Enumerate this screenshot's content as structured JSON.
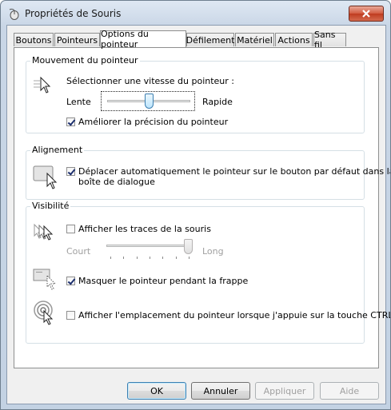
{
  "window": {
    "title": "Propriétés de Souris",
    "close_icon": "close-icon"
  },
  "tabs": [
    {
      "label": "Boutons",
      "active": false
    },
    {
      "label": "Pointeurs",
      "active": false
    },
    {
      "label": "Options du pointeur",
      "active": true
    },
    {
      "label": "Défilement",
      "active": false
    },
    {
      "label": "Matériel",
      "active": false
    },
    {
      "label": "Actions",
      "active": false
    },
    {
      "label": "Sans fil",
      "active": false
    }
  ],
  "motion": {
    "legend": "Mouvement du pointeur",
    "prompt": "Sélectionner une vitesse du pointeur :",
    "slow_label": "Lente",
    "fast_label": "Rapide",
    "speed_fraction": 0.5,
    "precision_label": "Améliorer la précision du pointeur",
    "precision_checked": true,
    "icon": "pointer-speed-icon"
  },
  "snap": {
    "legend": "Alignement",
    "line1": "Déplacer automatiquement le pointeur sur le bouton par défaut dans la",
    "line2": "boîte de dialogue",
    "checked": true,
    "icon": "snap-to-default-icon"
  },
  "visibility": {
    "legend": "Visibilité",
    "trails_label": "Afficher les traces de la souris",
    "trails_checked": false,
    "short_label": "Court",
    "long_label": "Long",
    "trails_fraction": 1.0,
    "hide_label": "Masquer le pointeur pendant la frappe",
    "hide_checked": true,
    "ctrl_label": "Afficher l'emplacement du pointeur lorsque j'appuie sur la touche CTRL",
    "ctrl_checked": false
  },
  "buttons": {
    "ok": "OK",
    "cancel": "Annuler",
    "apply": "Appliquer",
    "help": "Aide"
  }
}
